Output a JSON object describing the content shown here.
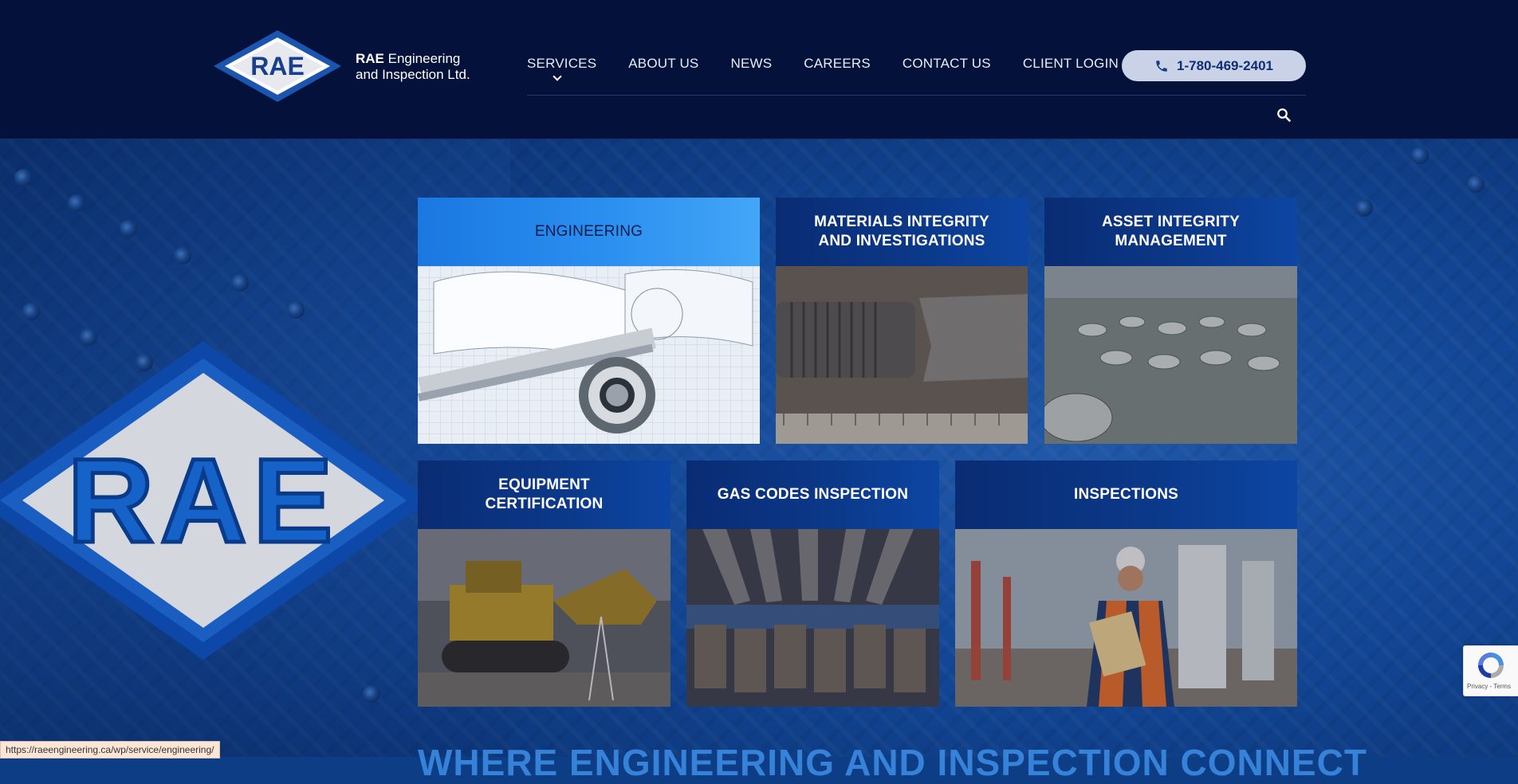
{
  "header": {
    "logo_mark": "RAE",
    "logo_line1_bold": "RAE",
    "logo_line1_rest": " Engineering",
    "logo_line2": "and Inspection Ltd.",
    "nav": [
      {
        "label": "SERVICES"
      },
      {
        "label": "ABOUT US"
      },
      {
        "label": "NEWS"
      },
      {
        "label": "CAREERS"
      },
      {
        "label": "CONTACT US"
      },
      {
        "label": "CLIENT LOGIN"
      }
    ],
    "phone": "1-780-469-2401"
  },
  "hero": {
    "big_logo_text": "RAE"
  },
  "services": [
    {
      "title": "ENGINEERING",
      "active": true
    },
    {
      "title": "MATERIALS INTEGRITY AND INVESTIGATIONS",
      "line1": "MATERIALS INTEGRITY",
      "line2": "AND INVESTIGATIONS"
    },
    {
      "title": "ASSET INTEGRITY MANAGEMENT",
      "line1": "ASSET INTEGRITY",
      "line2": "MANAGEMENT"
    },
    {
      "title": "EQUIPMENT CERTIFICATION",
      "line1": "EQUIPMENT",
      "line2": "CERTIFICATION"
    },
    {
      "title": "GAS CODES INSPECTION"
    },
    {
      "title": "INSPECTIONS"
    }
  ],
  "headline": "WHERE ENGINEERING AND INSPECTION CONNECT",
  "status_url": "https://raeengineering.ca/wp/service/engineering/",
  "recaptcha_label": "Privacy - Terms",
  "colors": {
    "header_bg": "#03113b",
    "tile_head": "#0b3888",
    "tile_active": "#2b8ff0",
    "phone_bg": "#c9d2e6",
    "phone_text": "#0f2f74"
  }
}
